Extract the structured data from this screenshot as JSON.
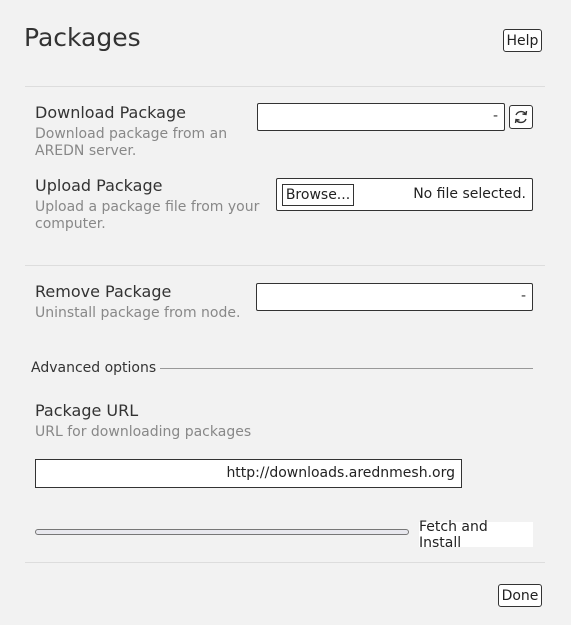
{
  "header": {
    "title": "Packages",
    "help_label": "Help"
  },
  "download": {
    "label": "Download Package",
    "description": "Download package from an AREDN server.",
    "selected": "-",
    "refresh_icon": "refresh-icon"
  },
  "upload": {
    "label": "Upload Package",
    "description": "Upload a package file from your computer.",
    "browse_label": "Browse...",
    "file_status": "No file selected."
  },
  "remove": {
    "label": "Remove Package",
    "description": "Uninstall package from node.",
    "selected": "-"
  },
  "advanced": {
    "legend": "Advanced options",
    "url_label": "Package URL",
    "url_description": "URL for downloading packages",
    "url_value": "http://downloads.arednmesh.org"
  },
  "install": {
    "progress": 0,
    "fetch_label": "Fetch and Install"
  },
  "footer": {
    "done_label": "Done"
  }
}
